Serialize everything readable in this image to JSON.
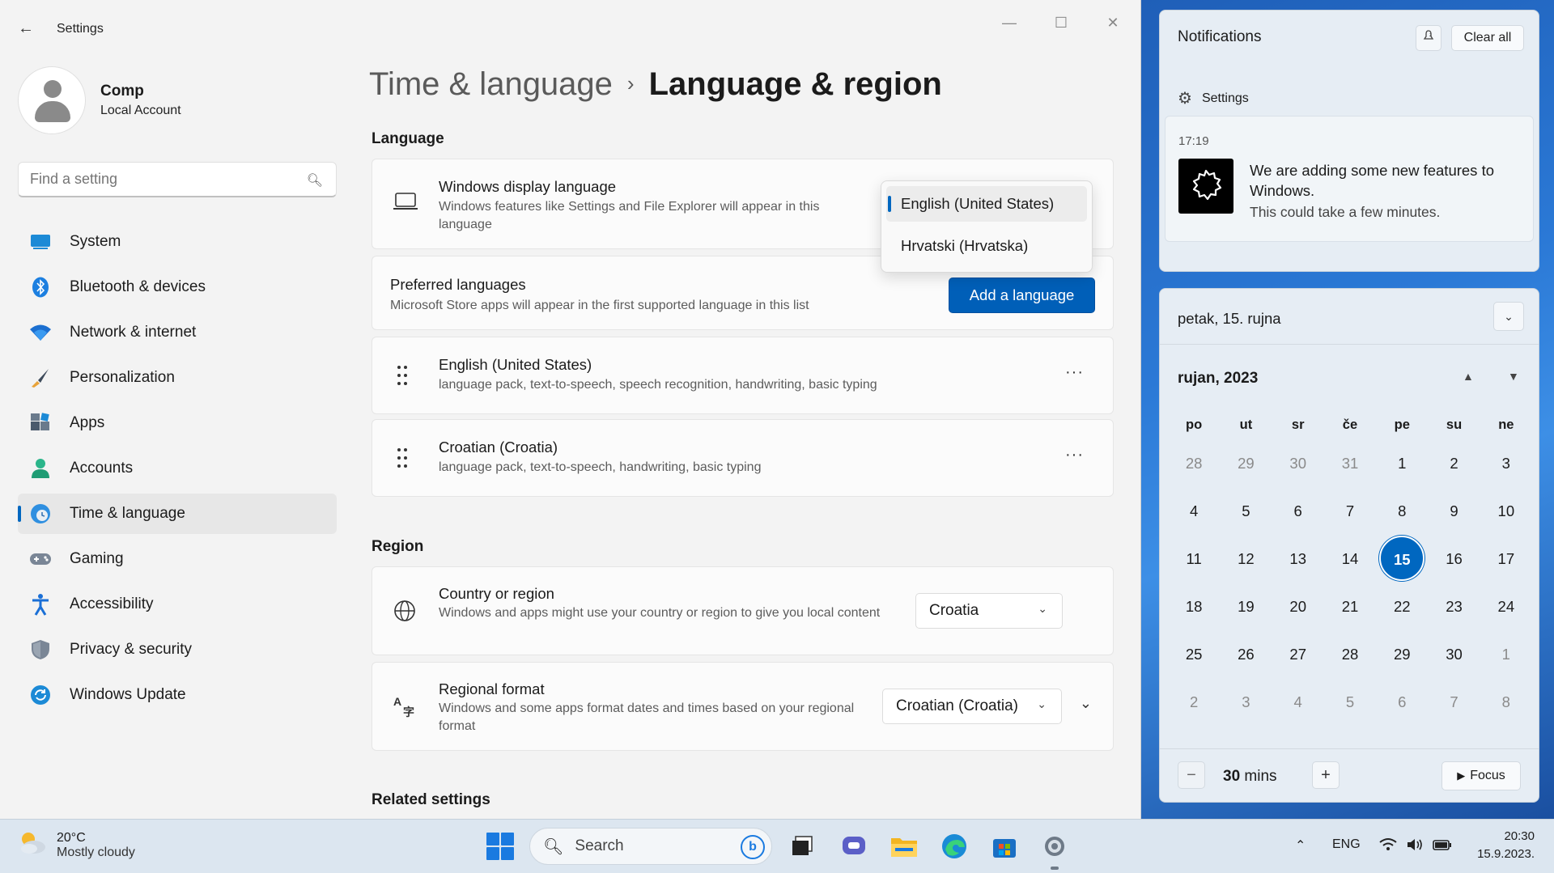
{
  "window": {
    "title": "Settings",
    "back_label": "←",
    "minimize": "—",
    "maximize": "☐",
    "close": "✕"
  },
  "profile": {
    "name": "Comp",
    "account_type": "Local Account"
  },
  "search": {
    "placeholder": "Find a setting"
  },
  "sidebar": {
    "items": [
      {
        "label": "System",
        "icon": "system-icon"
      },
      {
        "label": "Bluetooth & devices",
        "icon": "bluetooth-icon"
      },
      {
        "label": "Network & internet",
        "icon": "wifi-icon"
      },
      {
        "label": "Personalization",
        "icon": "brush-icon"
      },
      {
        "label": "Apps",
        "icon": "apps-icon"
      },
      {
        "label": "Accounts",
        "icon": "accounts-icon"
      },
      {
        "label": "Time & language",
        "icon": "time-language-icon"
      },
      {
        "label": "Gaming",
        "icon": "gaming-icon"
      },
      {
        "label": "Accessibility",
        "icon": "accessibility-icon"
      },
      {
        "label": "Privacy & security",
        "icon": "shield-icon"
      },
      {
        "label": "Windows Update",
        "icon": "update-icon"
      }
    ],
    "active_index": 6
  },
  "breadcrumb": {
    "parent": "Time & language",
    "separator": "›",
    "current": "Language & region"
  },
  "language_section": {
    "title": "Language",
    "display_language": {
      "title": "Windows display language",
      "description": "Windows features like Settings and File Explorer will appear in this language"
    },
    "preferred": {
      "title": "Preferred languages",
      "description": "Microsoft Store apps will appear in the first supported language in this list",
      "add_button": "Add a language"
    },
    "languages": [
      {
        "name": "English (United States)",
        "features": "language pack, text-to-speech, speech recognition, handwriting, basic typing"
      },
      {
        "name": "Croatian (Croatia)",
        "features": "language pack, text-to-speech, handwriting, basic typing"
      }
    ],
    "more_label": "···"
  },
  "display_dropdown": {
    "options": [
      "English (United States)",
      "Hrvatski (Hrvatska)"
    ],
    "selected_index": 0
  },
  "region_section": {
    "title": "Region",
    "country": {
      "title": "Country or region",
      "description": "Windows and apps might use your country or region to give you local content",
      "value": "Croatia"
    },
    "format": {
      "title": "Regional format",
      "description": "Windows and some apps format dates and times based on your regional format",
      "value": "Croatian (Croatia)"
    }
  },
  "related": {
    "title": "Related settings"
  },
  "notifications": {
    "title": "Notifications",
    "clear_all": "Clear all",
    "app_name": "Settings",
    "time": "17:19",
    "message_title": "We are adding some new features to Windows.",
    "message_body": "This could take a few minutes."
  },
  "calendar": {
    "date_header": "petak, 15. rujna",
    "month_label": "rujan, 2023",
    "weekdays": [
      "po",
      "ut",
      "sr",
      "če",
      "pe",
      "su",
      "ne"
    ],
    "weeks": [
      [
        "28",
        "29",
        "30",
        "31",
        "1",
        "2",
        "3"
      ],
      [
        "4",
        "5",
        "6",
        "7",
        "8",
        "9",
        "10"
      ],
      [
        "11",
        "12",
        "13",
        "14",
        "15",
        "16",
        "17"
      ],
      [
        "18",
        "19",
        "20",
        "21",
        "22",
        "23",
        "24"
      ],
      [
        "25",
        "26",
        "27",
        "28",
        "29",
        "30",
        "1"
      ],
      [
        "2",
        "3",
        "4",
        "5",
        "6",
        "7",
        "8"
      ]
    ],
    "today": "15",
    "focus": {
      "minus": "−",
      "minutes": "30",
      "unit": "mins",
      "plus": "+",
      "button": "Focus"
    }
  },
  "taskbar": {
    "weather_temp": "20°C",
    "weather_desc": "Mostly cloudy",
    "search_label": "Search",
    "language": "ENG",
    "time": "20:30",
    "date": "15.9.2023.",
    "accent": "#0067c0"
  }
}
